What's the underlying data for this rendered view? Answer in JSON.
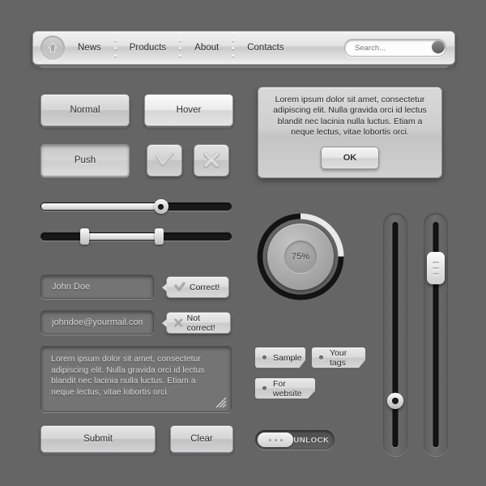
{
  "theme": {
    "background": "#656566",
    "panel_light": "#d6d6d7",
    "track_dark": "#181818",
    "text_dark": "#2d2d2d",
    "text_light": "#d6d6d7"
  },
  "navbar": {
    "home_icon": "home-icon",
    "links": [
      "News",
      "Products",
      "About",
      "Contacts"
    ],
    "search": {
      "placeholder": "Search...",
      "value": "",
      "button_icon": "search-icon"
    }
  },
  "buttons": {
    "normal": "Normal",
    "hover": "Hover",
    "push": "Push",
    "check_icon": "check-icon",
    "cross_icon": "cross-icon",
    "submit": "Submit",
    "clear": "Clear"
  },
  "dialog": {
    "text": "Lorem ipsum dolor sit amet, consectetur adipiscing elit. Nulla gravida orci id lectus blandit nec lacinia nulla luctus. Etiam a neque lectus, vitae lobortis orci.",
    "ok_label": "OK"
  },
  "sliders": {
    "horizontal_single": {
      "value": 63,
      "min": 0,
      "max": 100
    },
    "horizontal_range": {
      "low": 23,
      "high": 62,
      "min": 0,
      "max": 100
    },
    "vertical_left": {
      "value": 80,
      "min": 0,
      "max": 100,
      "knob": "round-knob"
    },
    "vertical_right": {
      "value": 20,
      "min": 0,
      "max": 100,
      "knob": "rect-knob"
    }
  },
  "form": {
    "name_value": "John Doe",
    "name_placeholder": "John Doe",
    "email_value": "johndoe@yourmail.com",
    "email_placeholder": "johndoe@yourmail.com",
    "textarea_value": "Lorem ipsum dolor sit amet, consectetur adipiscing elit. Nulla gravida orci id lectus blandit nec lacinia nulla luctus. Etiam a neque lectus, vitae lobortis orci.",
    "tooltip_correct": "Correct!",
    "tooltip_incorrect": "Not correct!"
  },
  "dial": {
    "percent_label": "75%",
    "value": 75,
    "min": 0,
    "max": 100
  },
  "tags": [
    "Sample",
    "Your tags",
    "For website"
  ],
  "unlock": {
    "label": "UNLOCK",
    "knob_icon": "grip-dots-icon"
  }
}
